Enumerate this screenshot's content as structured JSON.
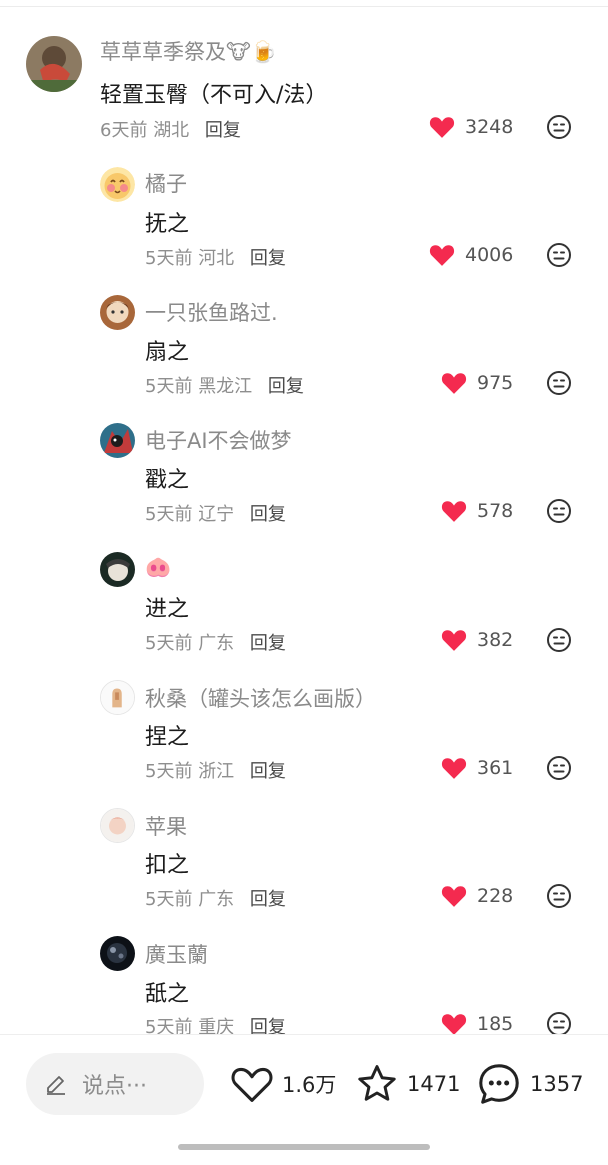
{
  "comments": [
    {
      "name": "草草草季祭及🐮🍺",
      "text": "轻置玉臀（不可入/法）",
      "time": "6天前",
      "location": "湖北",
      "reply": "回复",
      "likes": "3248"
    },
    {
      "name": "橘子",
      "text": "抚之",
      "time": "5天前",
      "location": "河北",
      "reply": "回复",
      "likes": "4006"
    },
    {
      "name": "一只张鱼路过.",
      "text": "扇之",
      "time": "5天前",
      "location": "黑龙江",
      "reply": "回复",
      "likes": "975"
    },
    {
      "name": "电子AI不会做梦",
      "text": "戳之",
      "time": "5天前",
      "location": "辽宁",
      "reply": "回复",
      "likes": "578"
    },
    {
      "name": "🐽",
      "text": "进之",
      "time": "5天前",
      "location": "广东",
      "reply": "回复",
      "likes": "382"
    },
    {
      "name": "秋桑（罐头该怎么画版）",
      "text": "捏之",
      "time": "5天前",
      "location": "浙江",
      "reply": "回复",
      "likes": "361"
    },
    {
      "name": "苹果",
      "text": "扣之",
      "time": "5天前",
      "location": "广东",
      "reply": "回复",
      "likes": "228"
    },
    {
      "name": "廣玉蘭",
      "text": "舐之",
      "time": "5天前",
      "location": "重庆",
      "reply": "回复",
      "likes": "185"
    }
  ],
  "bottom_bar": {
    "input_placeholder": "说点···",
    "like_count": "1.6万",
    "favorite_count": "1471",
    "comment_count": "1357"
  },
  "colors": {
    "heart": "#f42a4f",
    "muted_text": "#8e8e8e"
  }
}
